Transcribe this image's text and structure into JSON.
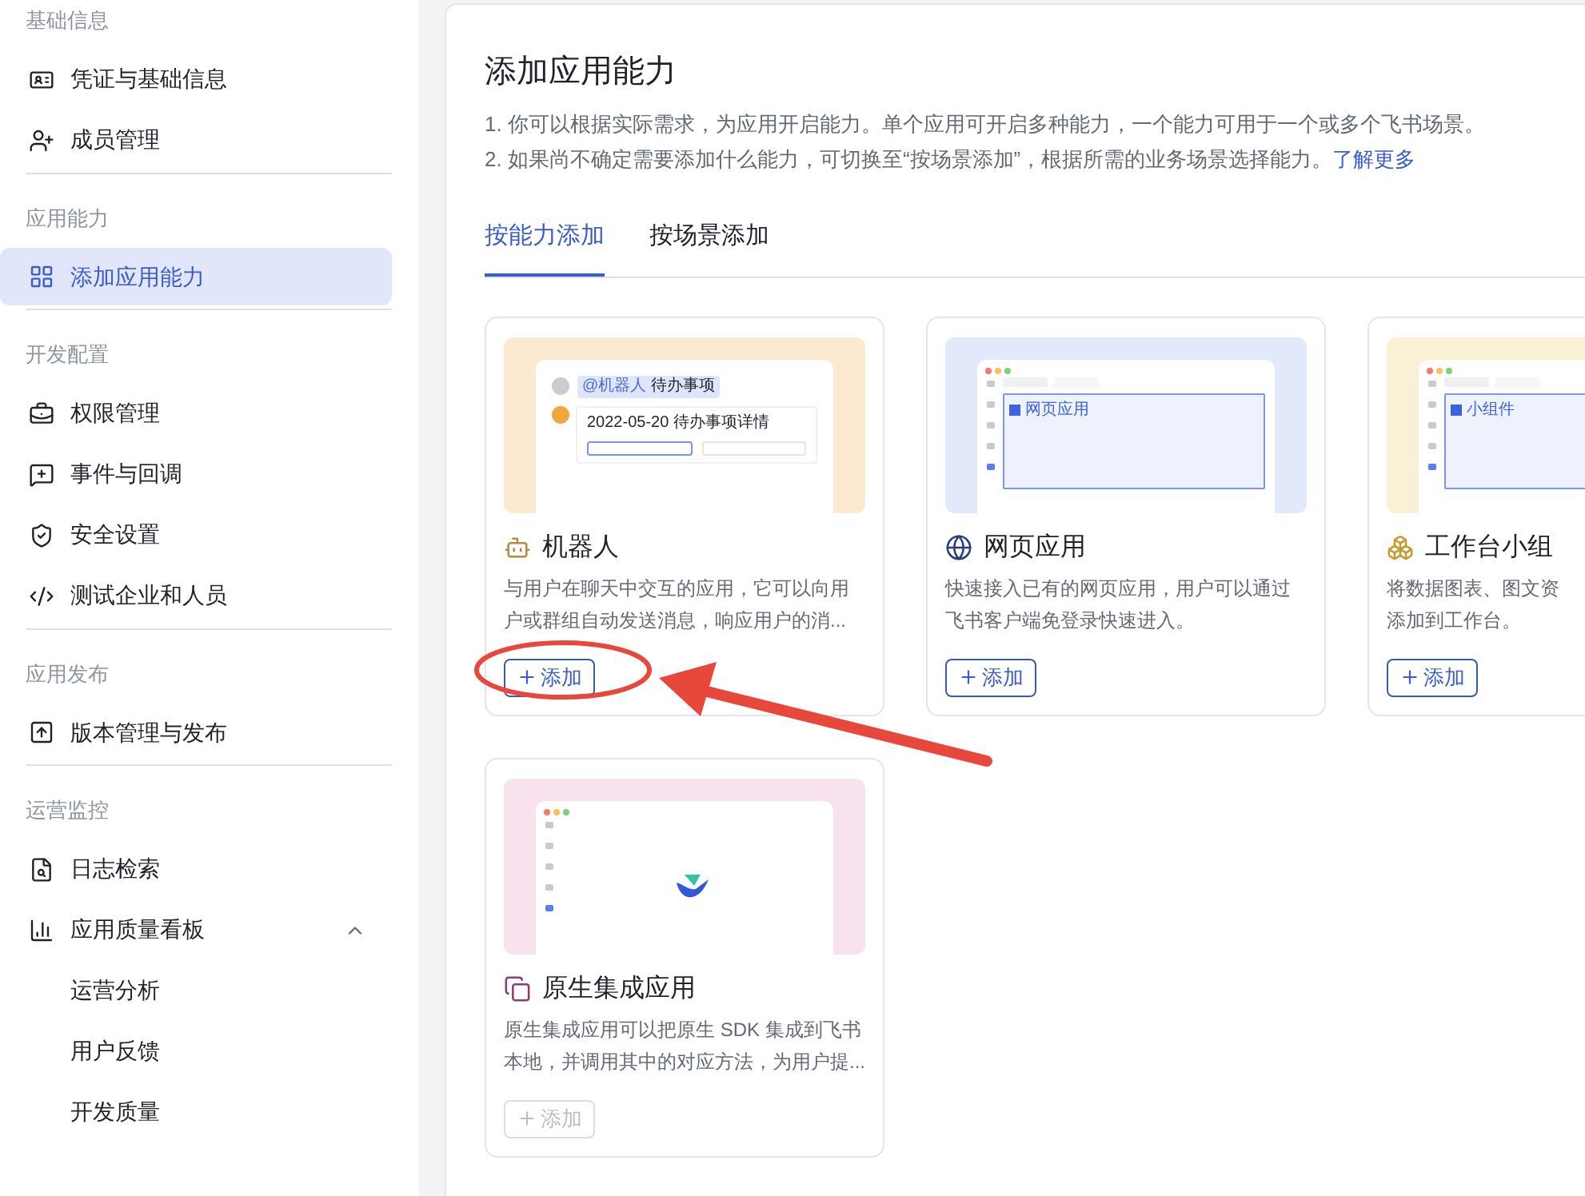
{
  "sidebar": {
    "sections": [
      {
        "title": "基础信息",
        "items": [
          {
            "label": "凭证与基础信息",
            "selected": false
          },
          {
            "label": "成员管理",
            "selected": false
          }
        ]
      },
      {
        "title": "应用能力",
        "items": [
          {
            "label": "添加应用能力",
            "selected": true
          }
        ]
      },
      {
        "title": "开发配置",
        "items": [
          {
            "label": "权限管理",
            "selected": false
          },
          {
            "label": "事件与回调",
            "selected": false
          },
          {
            "label": "安全设置",
            "selected": false
          },
          {
            "label": "测试企业和人员",
            "selected": false
          }
        ]
      },
      {
        "title": "应用发布",
        "items": [
          {
            "label": "版本管理与发布",
            "selected": false
          }
        ]
      },
      {
        "title": "运营监控",
        "items": [
          {
            "label": "日志检索",
            "selected": false
          },
          {
            "label": "应用质量看板",
            "selected": false,
            "expanded": true,
            "children": [
              {
                "label": "运营分析",
                "selected": false
              },
              {
                "label": "用户反馈",
                "selected": false
              },
              {
                "label": "开发质量",
                "selected": false
              }
            ]
          }
        ]
      }
    ]
  },
  "main": {
    "title": "添加应用能力",
    "notes": [
      "1. 你可以根据实际需求，为应用开启能力。单个应用可开启多种能力，一个能力可用于一个或多个飞书场景。",
      "2. 如果尚不确定需要添加什么能力，可切换至“按场景添加”，根据所需的业务场景选择能力。"
    ],
    "learn_more": "了解更多",
    "tabs": [
      {
        "label": "按能力添加",
        "selected": true
      },
      {
        "label": "按场景添加",
        "selected": false
      }
    ],
    "cards": [
      {
        "kind": "bot",
        "title": "机器人",
        "description": [
          "与用户在聊天中交互的应用，它可以向用",
          "户或群组自动发送消息，响应用户的消..."
        ],
        "button": {
          "label": "添加",
          "disabled": false
        },
        "preview": {
          "texts": [
            "@机器人",
            "待办事项",
            "2022-05-20 待办事项详情"
          ]
        }
      },
      {
        "kind": "web",
        "title": "网页应用",
        "description": [
          "快速接入已有的网页应用，用户可以通过",
          "飞书客户端免登录快速进入。"
        ],
        "button": {
          "label": "添加",
          "disabled": false
        },
        "preview": {
          "texts": [
            "网页应用"
          ]
        }
      },
      {
        "kind": "widget",
        "title": "工作台小组",
        "description": [
          "将数据图表、图文资",
          "添加到工作台。"
        ],
        "button": {
          "label": "添加",
          "disabled": false
        },
        "preview": {
          "texts": [
            "小组件"
          ]
        }
      },
      {
        "kind": "native",
        "title": "原生集成应用",
        "description": [
          "原生集成应用可以把原生 SDK 集成到飞书",
          "本地，并调用其中的对应方法，为用户提..."
        ],
        "button": {
          "label": "添加",
          "disabled": true
        }
      }
    ]
  }
}
